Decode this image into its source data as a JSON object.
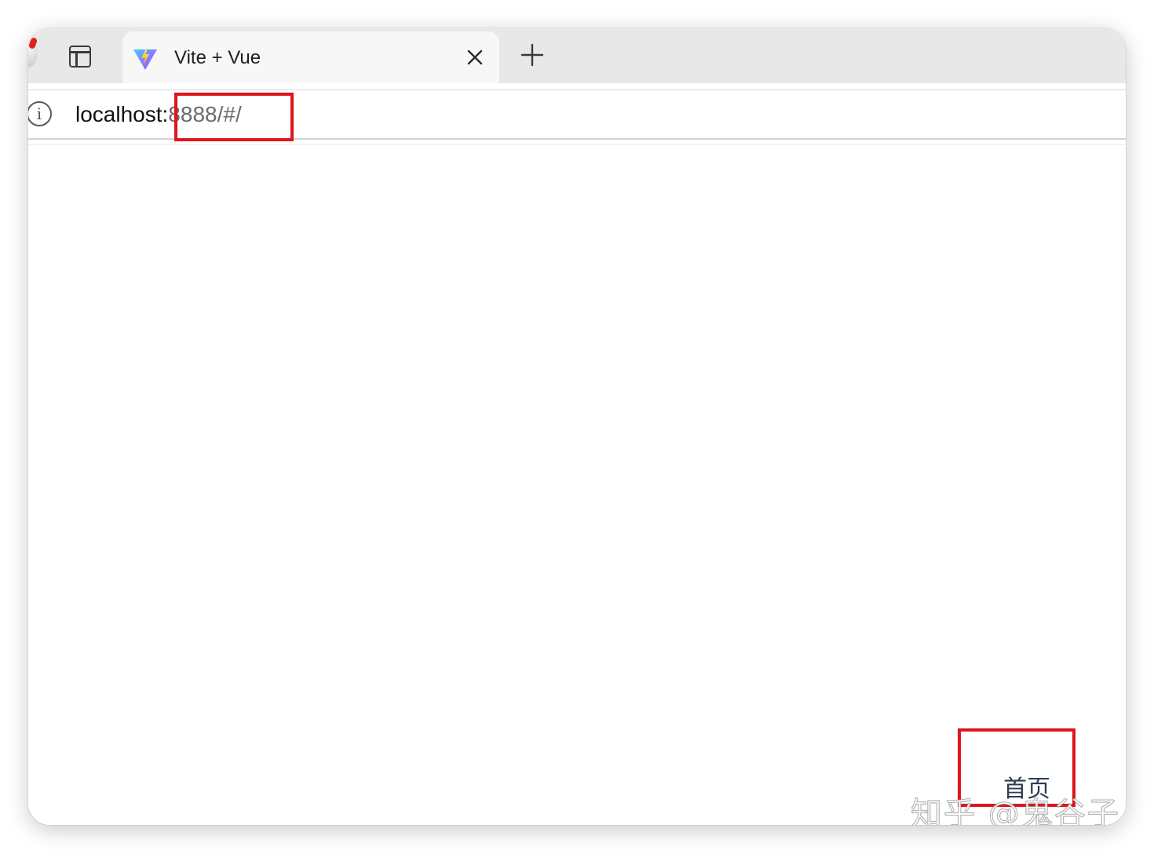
{
  "browser": {
    "tab": {
      "title": "Vite + Vue",
      "favicon": "vite-logo-icon",
      "close_icon": "close-icon"
    },
    "new_tab_icon": "plus-icon",
    "sidebar_icon": "sidebar-toggle-icon",
    "address_bar": {
      "info_icon_glyph": "i",
      "host": "localhost:",
      "rest": "8888/#/"
    }
  },
  "page": {
    "home_link": "首页"
  },
  "watermark": "知乎 @鬼谷子",
  "colors": {
    "highlight": "#e0141b",
    "link_text": "#2c3e50",
    "tabstrip": "#e8e8e8",
    "active_tab": "#f7f7f7"
  }
}
